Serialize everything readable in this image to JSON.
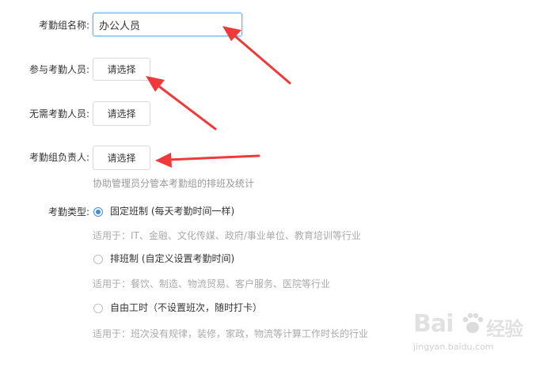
{
  "form": {
    "group_name": {
      "label": "考勤组名称:",
      "value": "办公人员"
    },
    "participants": {
      "label": "参与考勤人员:",
      "button": "请选择"
    },
    "exempt": {
      "label": "无需考勤人员:",
      "button": "请选择"
    },
    "manager": {
      "label": "考勤组负责人:",
      "button": "请选择",
      "hint": "协助管理员分管本考勤组的排班及统计"
    },
    "type": {
      "label": "考勤类型:",
      "options": [
        {
          "label": "固定班制 (每天考勤时间一样)",
          "desc": "适用于：IT、金融、文化传媒、政府/事业单位、教育培训等行业",
          "checked": true
        },
        {
          "label": "排班制 (自定义设置考勤时间)",
          "desc": "适用于：餐饮、制造、物流贸易、客户服务、医院等行业",
          "checked": false
        },
        {
          "label": "自由工时（不设置班次，随时打卡）",
          "desc": "适用于：班次没有规律，装修，家政，物流等计算工作时长的行业",
          "checked": false
        }
      ]
    }
  },
  "annotation_color": "#f0393a",
  "watermark": {
    "brand_a": "Bai",
    "brand_b": "经验",
    "url": "jingyan.baidu.com"
  }
}
